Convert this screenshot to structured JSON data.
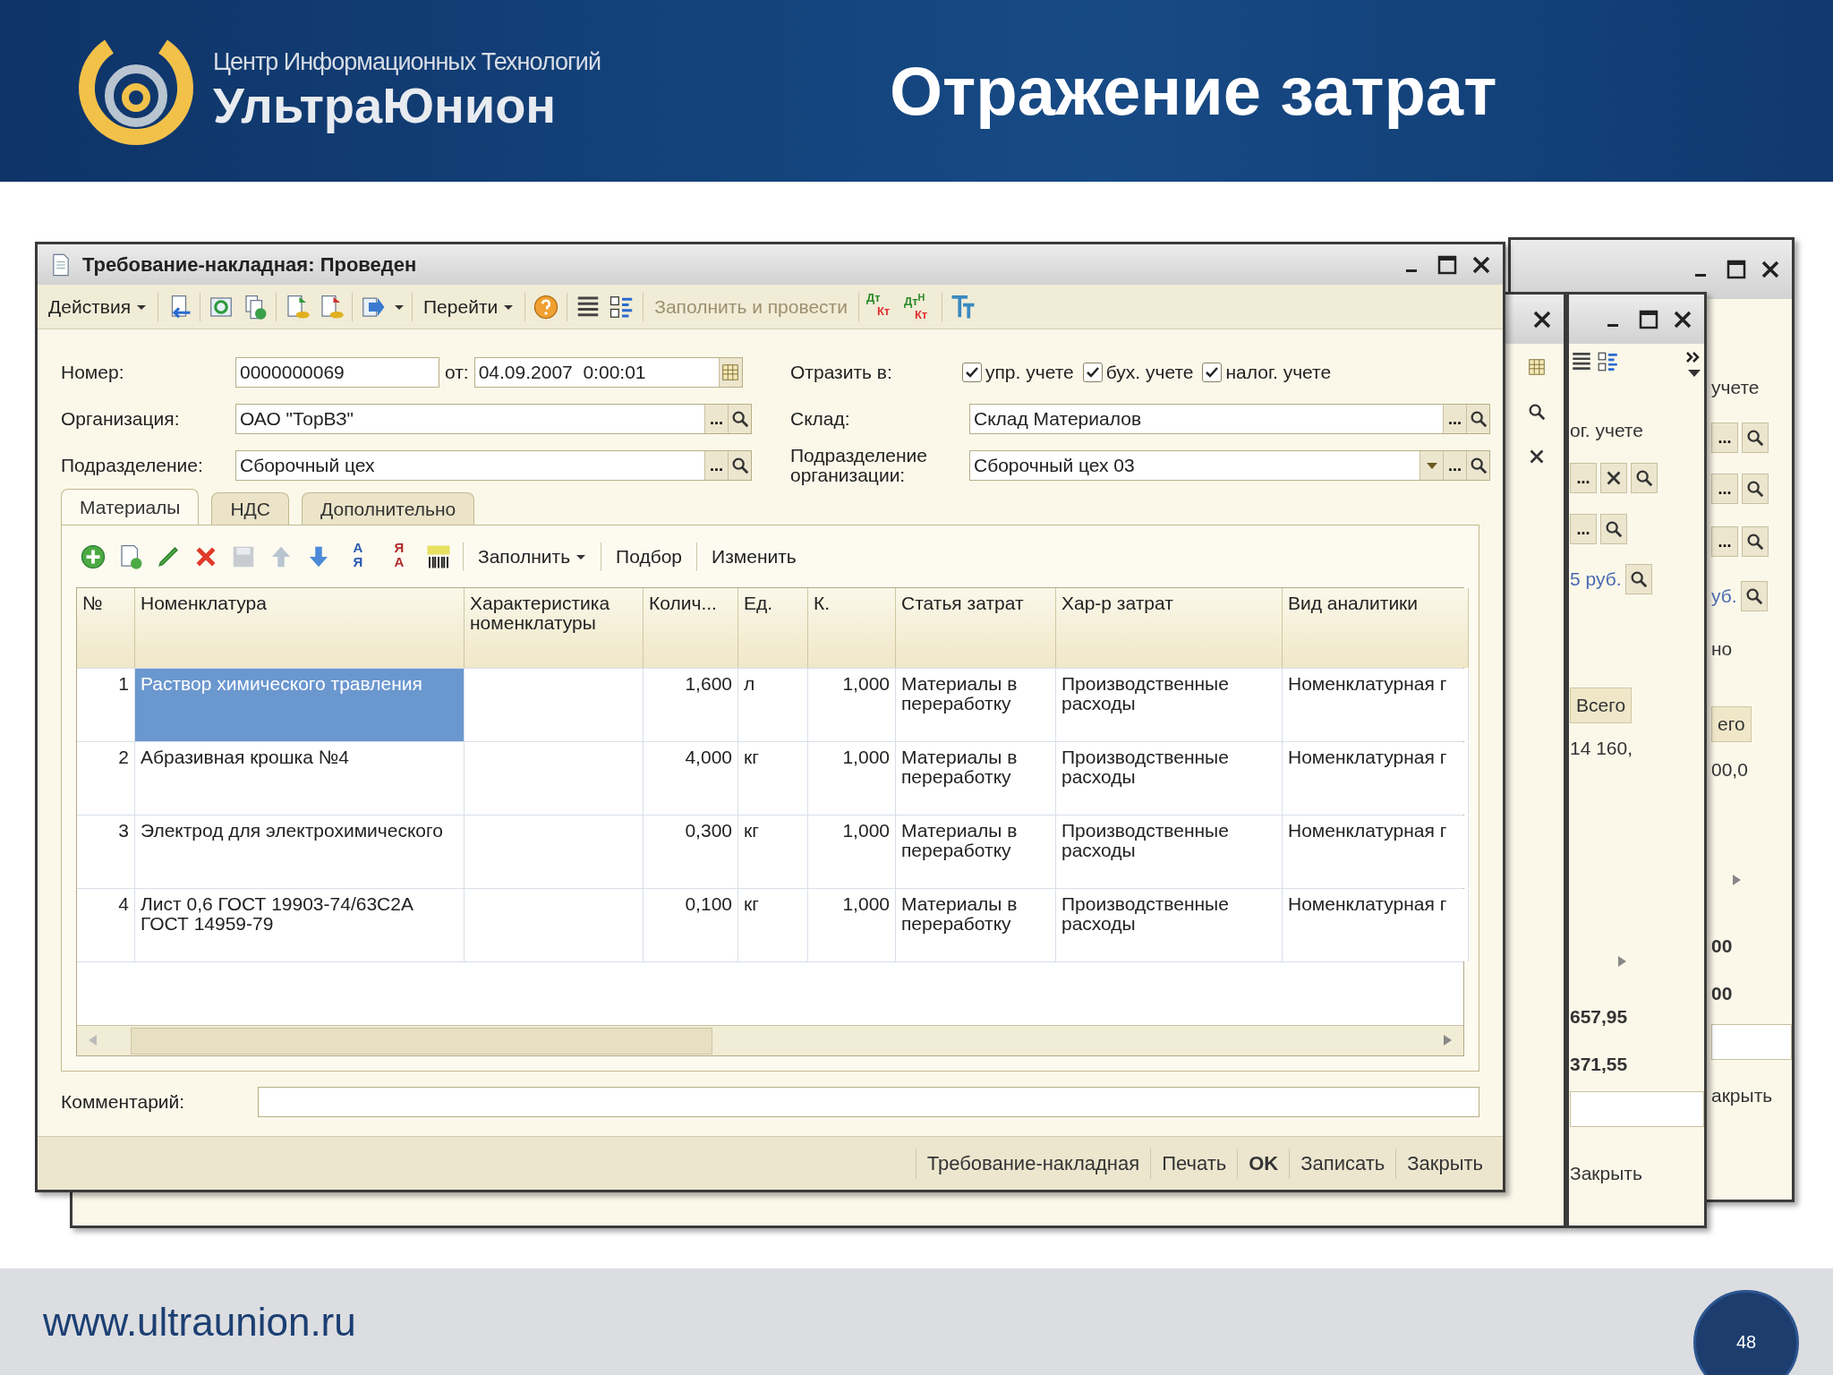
{
  "slide": {
    "org_caption": "Центр Информационных Технологий",
    "org_name": "УльтраЮнион",
    "title": "Отражение затрат",
    "website": "www.ultraunion.ru",
    "page_number": "48"
  },
  "window": {
    "title": "Требование-накладная: Проведен",
    "toolbar": {
      "actions": "Действия",
      "goto": "Перейти",
      "fill_and_post": "Заполнить и провести",
      "dt": "Дт",
      "kt": "Кт",
      "dt_tax": "Дт$^{Н}$",
      "kt_tax": "Кт"
    },
    "number": {
      "label": "Номер:",
      "value": "0000000069"
    },
    "date": {
      "label": "от:",
      "value": "04.09.2007  0:00:01"
    },
    "left_fields": [
      {
        "label": "Организация:",
        "value": "ОАО \"ТорВЗ\"",
        "select_button": "..."
      },
      {
        "label": "Подразделение:",
        "value": "Сборочный цех",
        "select_button": "..."
      }
    ],
    "reflect": {
      "label": "Отразить в:",
      "options": [
        {
          "label": "упр. учете",
          "checked": true
        },
        {
          "label": "бух. учете",
          "checked": true
        },
        {
          "label": "налог. учете",
          "checked": true
        }
      ]
    },
    "right_fields": [
      {
        "label": "Склад:",
        "value": "Склад Материалов",
        "select_button": "...",
        "dropdown": false
      },
      {
        "label": "Подразделение организации:",
        "value": "Сборочный цех 03",
        "select_button": "...",
        "dropdown": true
      }
    ],
    "tabs": [
      {
        "label": "Материалы",
        "selected": true
      },
      {
        "label": "НДС",
        "selected": false
      },
      {
        "label": "Дополнительно",
        "selected": false
      }
    ],
    "table_toolbar": {
      "sort_asc": [
        "А",
        "Я"
      ],
      "sort_desc": [
        "Я",
        "А"
      ],
      "fill": "Заполнить",
      "pick": "Подбор",
      "change": "Изменить"
    },
    "table": {
      "columns": [
        "№",
        "Номенклатура",
        "Характеристика номенклатуры",
        "Колич...",
        "Ед.",
        "К.",
        "Статья затрат",
        "Хар-р затрат",
        "Вид аналитики"
      ],
      "rows": [
        {
          "selected": true,
          "cells": [
            "1",
            "Раствор химического травления",
            "",
            "1,600",
            "л",
            "1,000",
            "Материалы в переработку",
            "Производственные расходы",
            "Номенклатурная г"
          ]
        },
        {
          "selected": false,
          "cells": [
            "2",
            "Абразивная крошка №4",
            "",
            "4,000",
            "кг",
            "1,000",
            "Материалы в переработку",
            "Производственные расходы",
            "Номенклатурная г"
          ]
        },
        {
          "selected": false,
          "cells": [
            "3",
            "Электрод для электрохимического",
            "",
            "0,300",
            "кг",
            "1,000",
            "Материалы в переработку",
            "Производственные расходы",
            "Номенклатурная г"
          ]
        },
        {
          "selected": false,
          "cells": [
            "4",
            "Лист 0,6 ГОСТ 19903-74/63С2А ГОСТ 14959-79",
            "",
            "0,100",
            "кг",
            "1,000",
            "Материалы в переработку",
            "Производственные расходы",
            "Номенклатурная г"
          ]
        }
      ]
    },
    "comment": {
      "label": "Комментарий:"
    },
    "buttons": [
      {
        "label": "Требование-накладная",
        "default": false
      },
      {
        "label": "Печать",
        "default": false
      },
      {
        "label": "OK",
        "default": true
      },
      {
        "label": "Записать",
        "default": false
      },
      {
        "label": "Закрыть",
        "default": false
      }
    ]
  },
  "back_window_right": {
    "checkbox_fragment": "учете",
    "select_buttons": [
      "...",
      "...",
      "..."
    ],
    "amount_fragment": "уб.",
    "tab_fragment": "но",
    "column_fragment": "его",
    "cell_fragment": "00,0",
    "totals": [
      "00",
      "00"
    ],
    "button_fragment": "акрыть"
  },
  "back_window_middle": {
    "checkbox_fragment": "ог. учете",
    "select_buttons": [
      "...",
      "..."
    ],
    "amount_fragment": "5 руб.",
    "column": "Всего",
    "cell_fragment": "14 160,",
    "totals": [
      "657,95",
      "371,55"
    ],
    "close_button": "Закрыть"
  }
}
